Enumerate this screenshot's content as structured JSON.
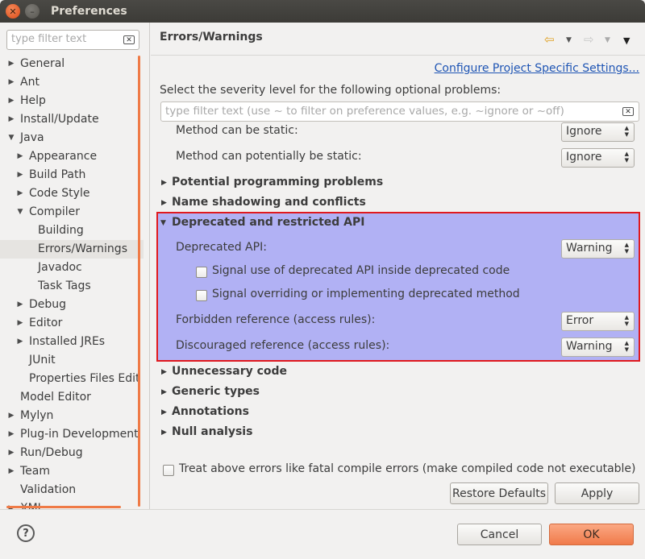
{
  "window": {
    "title": "Preferences",
    "close_glyph": "✕",
    "minimize_glyph": "–"
  },
  "left": {
    "filter_placeholder": "type filter text",
    "tree": [
      {
        "label": "General",
        "level": 0,
        "twisty": "collapsed"
      },
      {
        "label": "Ant",
        "level": 0,
        "twisty": "collapsed"
      },
      {
        "label": "Help",
        "level": 0,
        "twisty": "collapsed"
      },
      {
        "label": "Install/Update",
        "level": 0,
        "twisty": "collapsed"
      },
      {
        "label": "Java",
        "level": 0,
        "twisty": "expanded"
      },
      {
        "label": "Appearance",
        "level": 1,
        "twisty": "collapsed"
      },
      {
        "label": "Build Path",
        "level": 1,
        "twisty": "collapsed"
      },
      {
        "label": "Code Style",
        "level": 1,
        "twisty": "collapsed"
      },
      {
        "label": "Compiler",
        "level": 1,
        "twisty": "expanded"
      },
      {
        "label": "Building",
        "level": 2,
        "twisty": "none"
      },
      {
        "label": "Errors/Warnings",
        "level": 2,
        "twisty": "none",
        "selected": true
      },
      {
        "label": "Javadoc",
        "level": 2,
        "twisty": "none"
      },
      {
        "label": "Task Tags",
        "level": 2,
        "twisty": "none"
      },
      {
        "label": "Debug",
        "level": 1,
        "twisty": "collapsed"
      },
      {
        "label": "Editor",
        "level": 1,
        "twisty": "collapsed"
      },
      {
        "label": "Installed JREs",
        "level": 1,
        "twisty": "collapsed"
      },
      {
        "label": "JUnit",
        "level": 1,
        "twisty": "none"
      },
      {
        "label": "Properties Files Edit",
        "level": 1,
        "twisty": "none"
      },
      {
        "label": "Model Editor",
        "level": 0,
        "twisty": "none"
      },
      {
        "label": "Mylyn",
        "level": 0,
        "twisty": "collapsed"
      },
      {
        "label": "Plug-in Development",
        "level": 0,
        "twisty": "collapsed"
      },
      {
        "label": "Run/Debug",
        "level": 0,
        "twisty": "collapsed"
      },
      {
        "label": "Team",
        "level": 0,
        "twisty": "collapsed"
      },
      {
        "label": "Validation",
        "level": 0,
        "twisty": "none"
      },
      {
        "label": "XML",
        "level": 0,
        "twisty": "collapsed"
      }
    ]
  },
  "right": {
    "page_title": "Errors/Warnings",
    "nav_back_glyph": "⇦",
    "nav_forward_glyph": "⇨",
    "dropdown_glyph": "▼",
    "config_link": "Configure Project Specific Settings...",
    "severity_label": "Select the severity level for the following optional problems:",
    "filter_placeholder": "type filter text (use ~ to filter on preference values, e.g. ~ignore or ~off)",
    "rows": {
      "method_static": {
        "label": "Method can be static:",
        "value": "Ignore"
      },
      "method_potential_static": {
        "label": "Method can potentially be static:",
        "value": "Ignore"
      }
    },
    "sections": {
      "potential": "Potential programming problems",
      "shadowing": "Name shadowing and conflicts",
      "deprecated": "Deprecated and restricted API",
      "unnecessary": "Unnecessary code",
      "generic": "Generic types",
      "annotations": "Annotations",
      "null": "Null analysis"
    },
    "deprecated": {
      "deprecated_api": {
        "label": "Deprecated API:",
        "value": "Warning"
      },
      "signal_inside": {
        "label": "Signal use of deprecated API inside deprecated code",
        "checked": false
      },
      "signal_overriding": {
        "label": "Signal overriding or implementing deprecated method",
        "checked": false
      },
      "forbidden": {
        "label": "Forbidden reference (access rules):",
        "value": "Error"
      },
      "discouraged": {
        "label": "Discouraged reference (access rules):",
        "value": "Warning"
      }
    },
    "treat_fatal": {
      "label": "Treat above errors like fatal compile errors (make compiled code not executable)",
      "checked": false
    },
    "restore_defaults": "Restore Defaults",
    "apply": "Apply"
  },
  "footer": {
    "help_glyph": "?",
    "cancel": "Cancel",
    "ok": "OK"
  },
  "colors": {
    "highlight_fill": "#b1b1f4",
    "highlight_border": "#e0191e",
    "scrollbar": "#ef7a46",
    "link": "#1f55b4",
    "ok_button": "#f07a4a"
  }
}
